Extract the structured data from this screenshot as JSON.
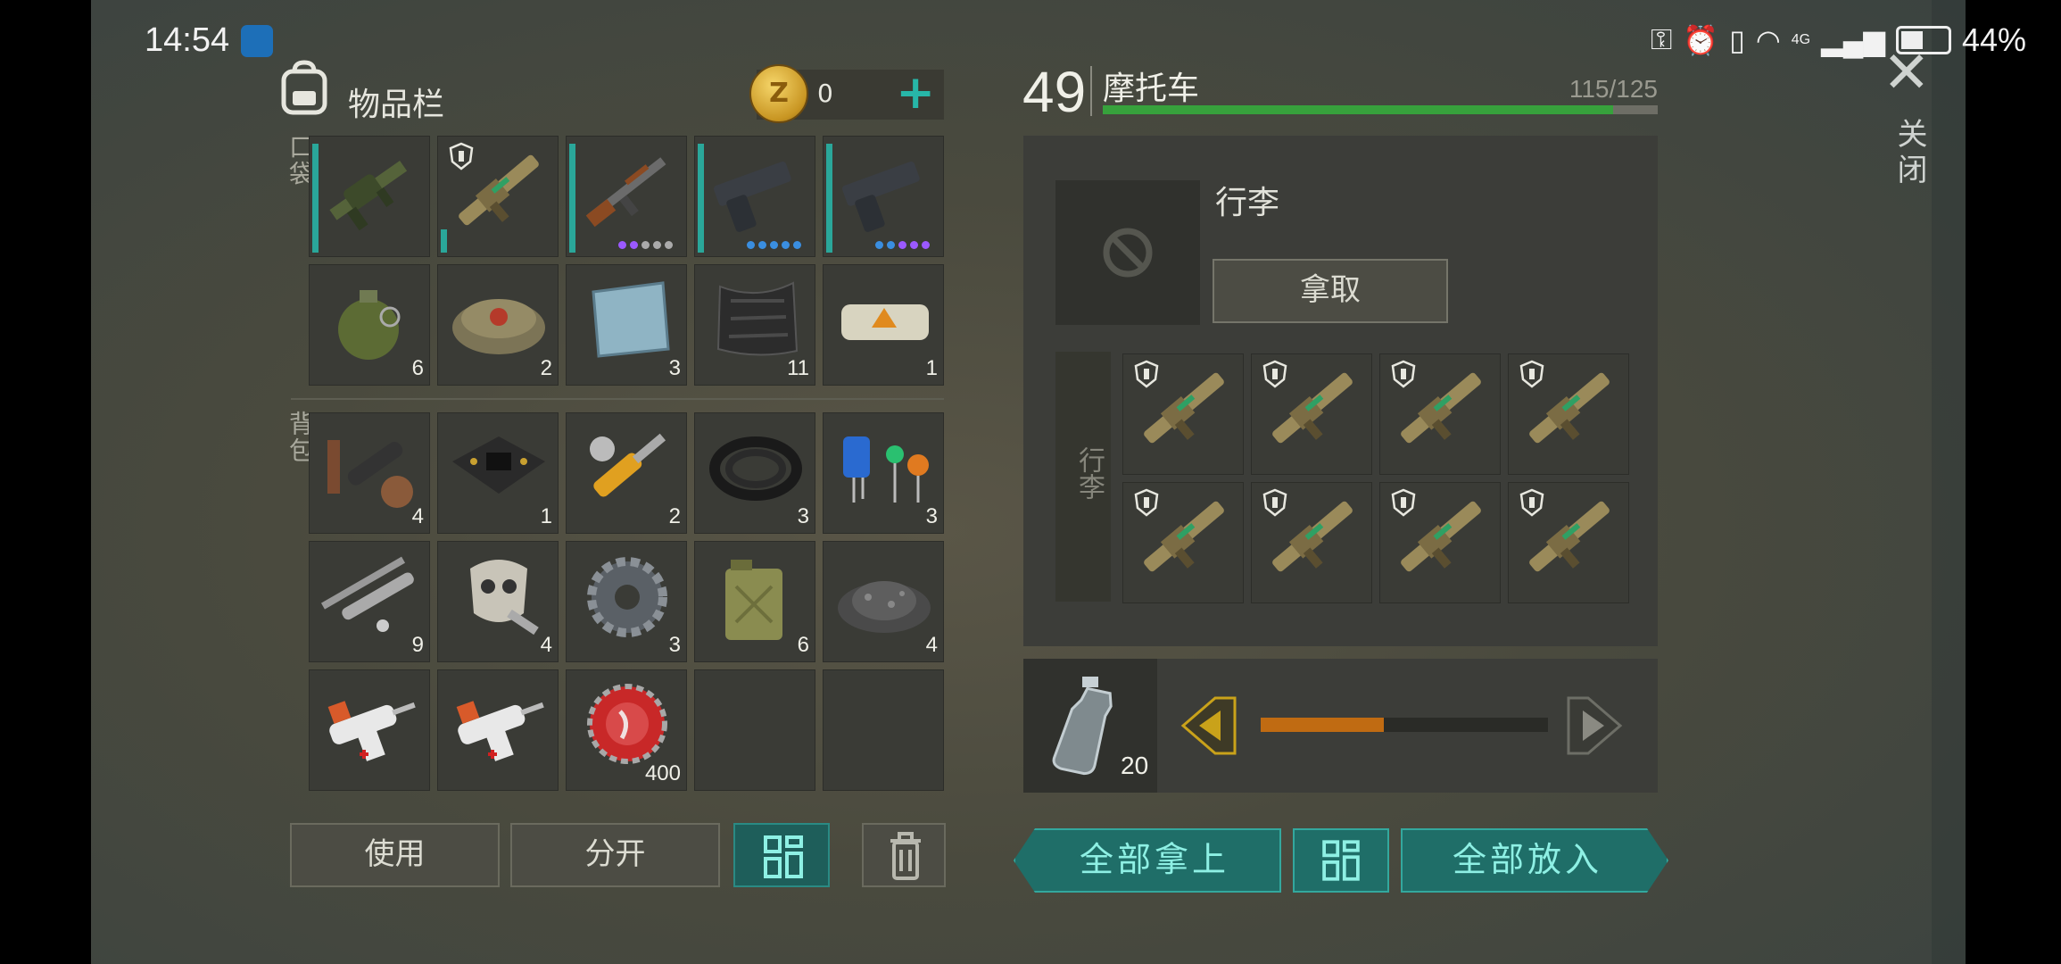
{
  "status_bar": {
    "time": "14:54",
    "right_icons": [
      "key-icon",
      "alarm-icon",
      "vibrate-icon",
      "wifi-icon",
      "signal-icon"
    ],
    "network": "4G",
    "battery": "44%"
  },
  "inventory": {
    "title": "物品栏",
    "coins": "0",
    "add_label": "+",
    "pocket_label": "口袋",
    "backpack_label": "背包",
    "pocket_slots": [
      {
        "icon": "grenade-launcher-icon",
        "qty": "",
        "durability": 0.95,
        "rarity": []
      },
      {
        "icon": "rocket-launcher-icon",
        "qty": "",
        "durability": 0.2,
        "shield": true,
        "rarity": []
      },
      {
        "icon": "ak-rifle-icon",
        "qty": "",
        "durability": 0.95,
        "rarity": [
          "#9b59ff",
          "#9b59ff",
          "#aaaaaa",
          "#aaaaaa",
          "#aaaaaa"
        ]
      },
      {
        "icon": "pistol-icon",
        "qty": "",
        "durability": 0.95,
        "rarity": [
          "#3a8ee0",
          "#3a8ee0",
          "#3a8ee0",
          "#3a8ee0",
          "#3a8ee0"
        ]
      },
      {
        "icon": "pistol-icon",
        "qty": "",
        "durability": 0.95,
        "rarity": [
          "#3a8ee0",
          "#3a8ee0",
          "#9b59ff",
          "#9b59ff",
          "#9b59ff"
        ]
      },
      {
        "icon": "frag-grenade-icon",
        "qty": "6"
      },
      {
        "icon": "landmine-icon",
        "qty": "2"
      },
      {
        "icon": "metal-plate-icon",
        "qty": "3"
      },
      {
        "icon": "carbon-fiber-icon",
        "qty": "11"
      },
      {
        "icon": "explosive-brick-icon",
        "qty": "1"
      }
    ],
    "backpack_slots": [
      {
        "icon": "scope-parts-icon",
        "qty": "4"
      },
      {
        "icon": "circuit-board-icon",
        "qty": "1"
      },
      {
        "icon": "hydraulic-cylinder-icon",
        "qty": "2"
      },
      {
        "icon": "rubber-hose-icon",
        "qty": "3"
      },
      {
        "icon": "capacitors-icon",
        "qty": "3"
      },
      {
        "icon": "metal-rods-icon",
        "qty": "9"
      },
      {
        "icon": "skull-mask-icon",
        "qty": "4"
      },
      {
        "icon": "gear-icon",
        "qty": "3"
      },
      {
        "icon": "jerrycan-icon",
        "qty": "6"
      },
      {
        "icon": "gravel-icon",
        "qty": "4"
      },
      {
        "icon": "medical-injector-icon",
        "qty": ""
      },
      {
        "icon": "medical-injector-icon",
        "qty": ""
      },
      {
        "icon": "bottle-cap-icon",
        "qty": "400"
      },
      {
        "icon": "empty",
        "qty": ""
      },
      {
        "icon": "empty",
        "qty": ""
      }
    ],
    "use_label": "使用",
    "split_label": "分开"
  },
  "vehicle": {
    "level": "49",
    "name": "摩托车",
    "capacity": "115/125",
    "capacity_fraction": 0.92,
    "compartment_title": "行李",
    "take_label": "拿取",
    "luggage_label": "行李",
    "storage_slots": [
      {
        "icon": "rocket-launcher-icon",
        "shield": true
      },
      {
        "icon": "rocket-launcher-icon",
        "shield": true
      },
      {
        "icon": "rocket-launcher-icon",
        "shield": true
      },
      {
        "icon": "rocket-launcher-icon",
        "shield": true
      },
      {
        "icon": "rocket-launcher-icon",
        "shield": true
      },
      {
        "icon": "rocket-launcher-icon",
        "shield": true
      },
      {
        "icon": "rocket-launcher-icon",
        "shield": true
      },
      {
        "icon": "rocket-launcher-icon",
        "shield": true
      }
    ],
    "fuel_item": "water-bottle-icon",
    "fuel_qty": "20",
    "fuel_fraction": 0.43,
    "take_all_label": "全部拿上",
    "put_all_label": "全部放入"
  },
  "close_label": "关闭",
  "colors": {
    "teal": "#27b6a8",
    "capacity_green": "#37a13c",
    "fuel_orange": "#c06b12",
    "arrow_gold": "#c9a21a"
  }
}
